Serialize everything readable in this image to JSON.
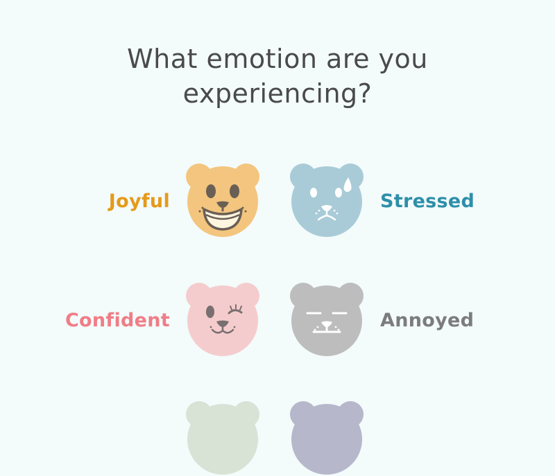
{
  "question": {
    "line1": "What emotion are you",
    "line2": "experiencing?"
  },
  "emotions": [
    {
      "label": "Joyful",
      "color": "#e59a1a",
      "bear_color": "#f3c57e",
      "icon": "joyful-bear-icon"
    },
    {
      "label": "Stressed",
      "color": "#2e8fa9",
      "bear_color": "#a9cbd8",
      "icon": "stressed-bear-icon"
    },
    {
      "label": "Confident",
      "color": "#f07d86",
      "bear_color": "#f5cccd",
      "icon": "confident-bear-icon"
    },
    {
      "label": "Annoyed",
      "color": "#7c7c7c",
      "bear_color": "#bdbdbd",
      "icon": "annoyed-bear-icon"
    },
    {
      "label": "",
      "color": "",
      "bear_color": "#d8e3d6",
      "icon": "bear-icon"
    },
    {
      "label": "",
      "color": "",
      "bear_color": "#b7b7cb",
      "icon": "bear-icon"
    }
  ]
}
